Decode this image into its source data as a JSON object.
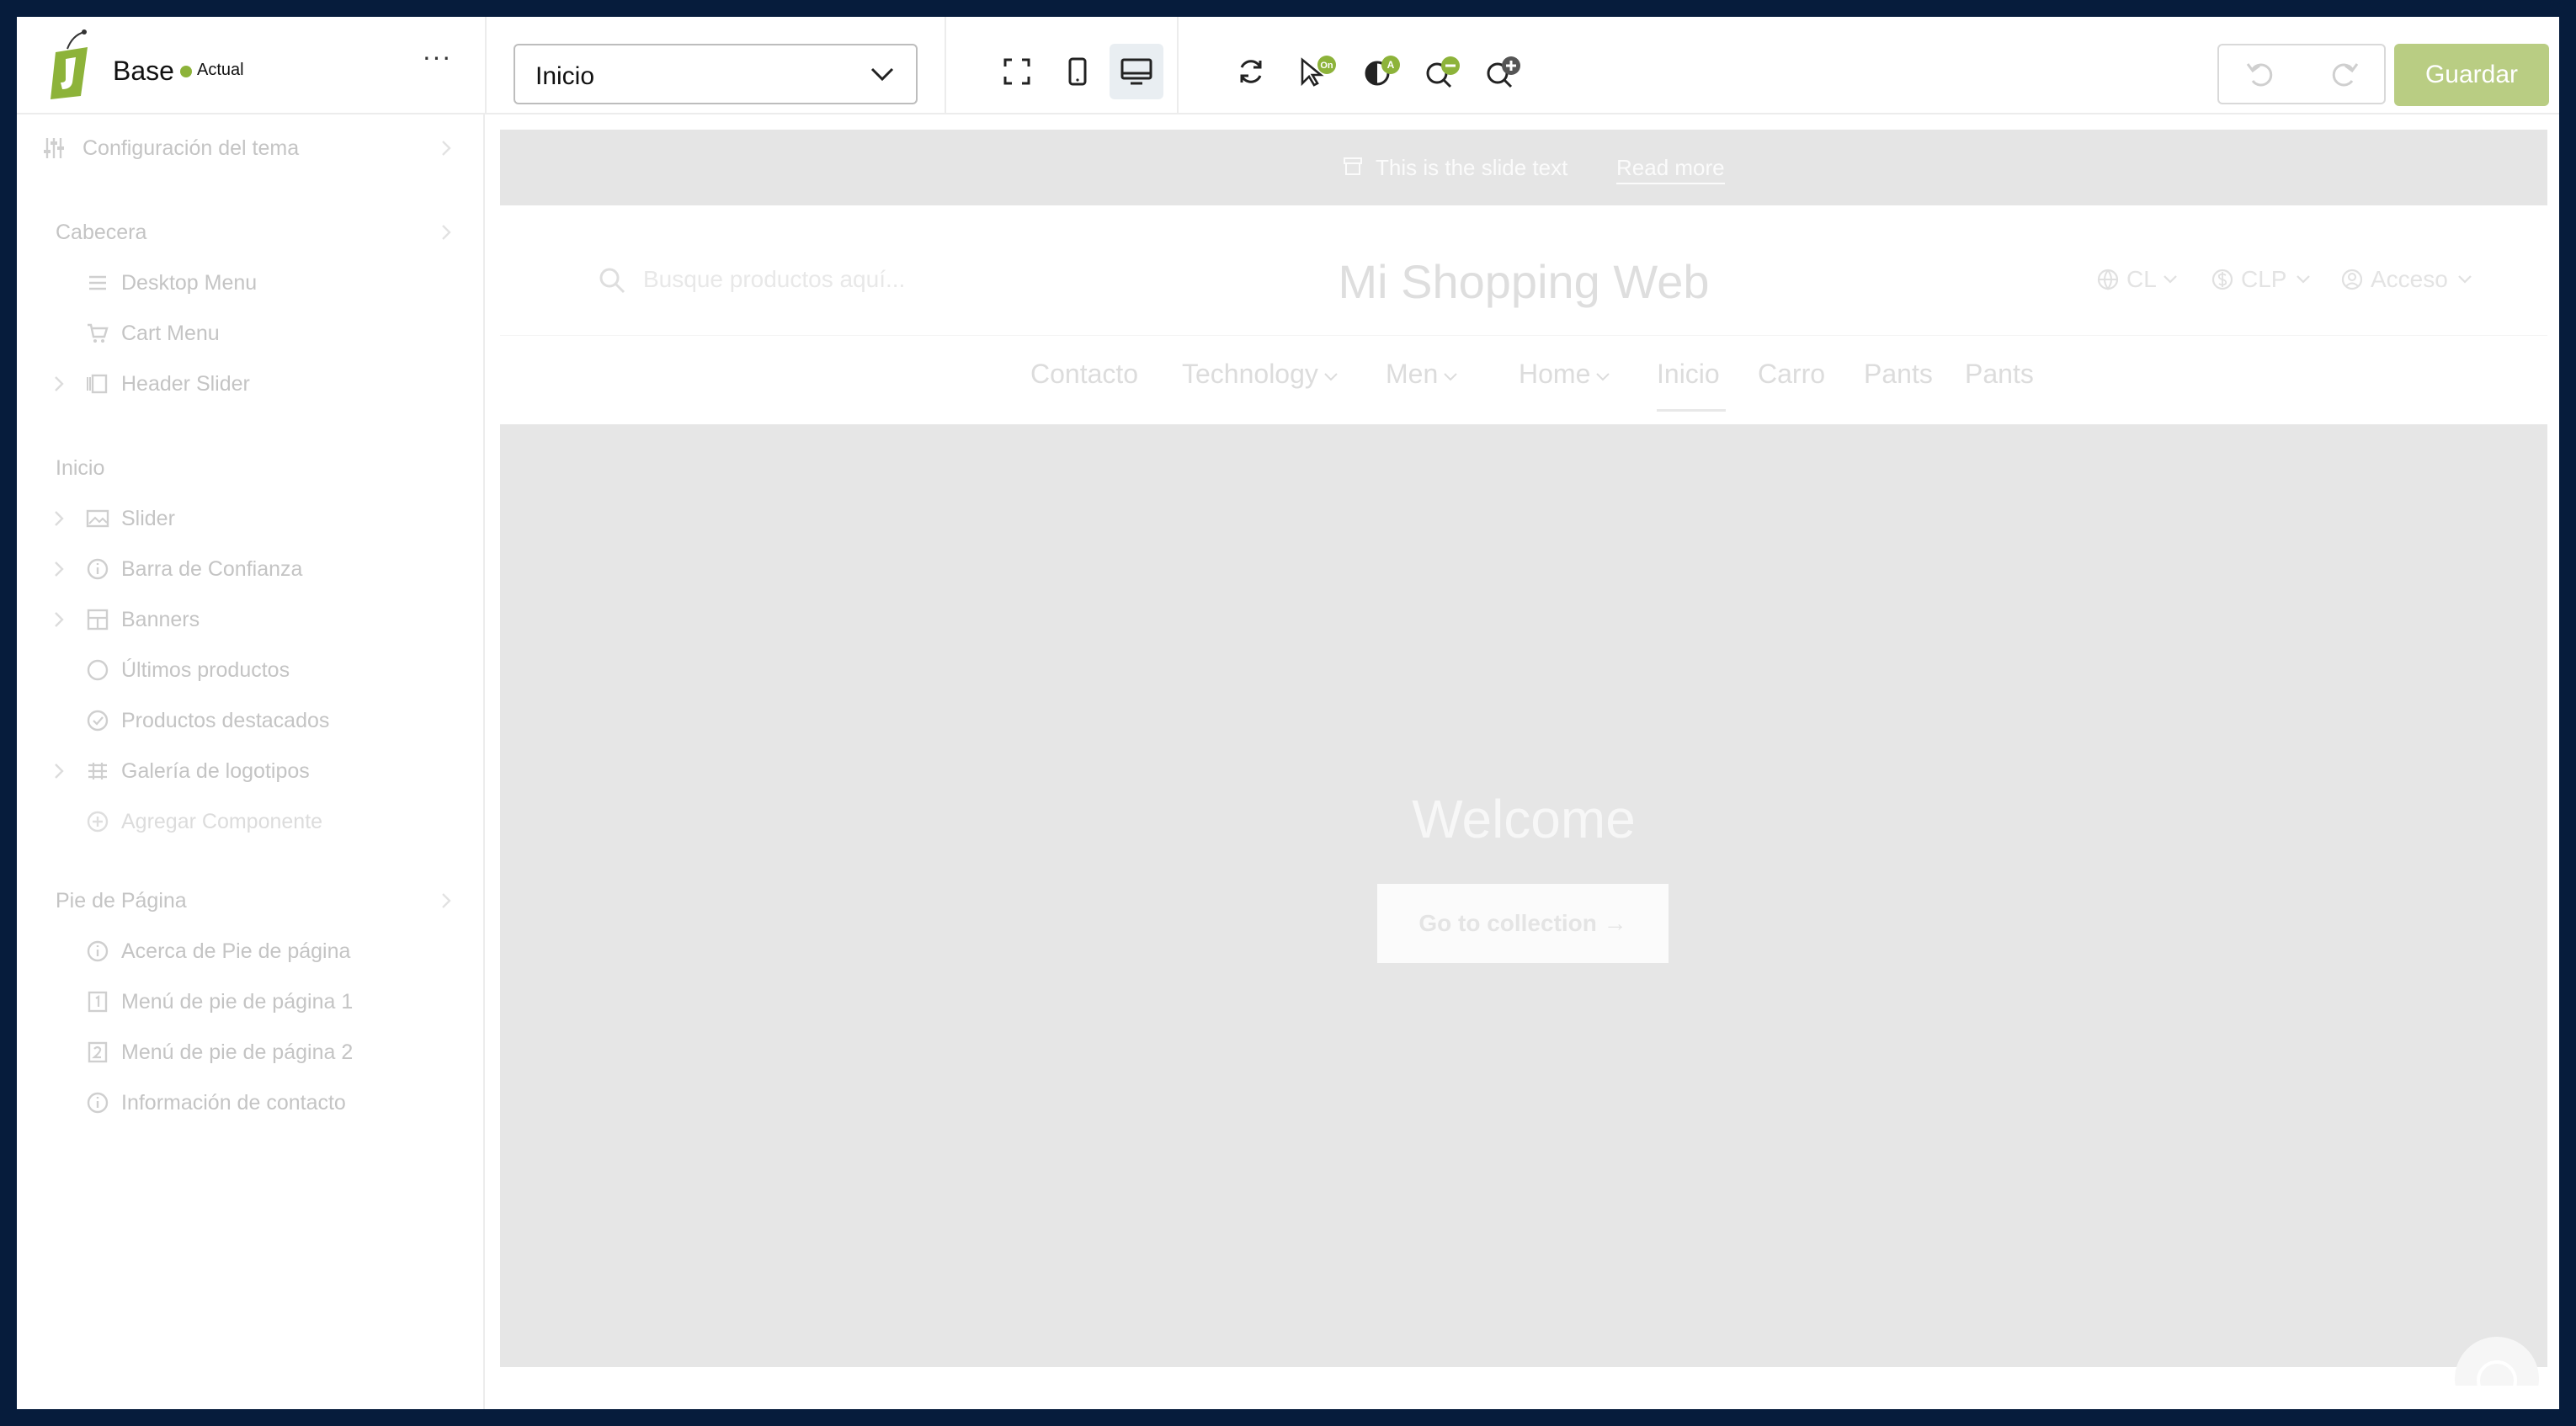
{
  "topbar": {
    "theme_name": "Base",
    "theme_status": "Actual",
    "more_label": "···",
    "page_select": {
      "value": "Inicio"
    },
    "save_label": "Guardar",
    "accent_color": "#8db33a"
  },
  "sidebar": {
    "theme_settings": "Configuración del tema",
    "groups": {
      "header": {
        "title": "Cabecera",
        "items": [
          {
            "label": "Desktop Menu",
            "icon": "menu-lines-icon"
          },
          {
            "label": "Cart Menu",
            "icon": "cart-icon"
          },
          {
            "label": "Header Slider",
            "icon": "slider-icon",
            "expandable": true
          }
        ]
      },
      "home": {
        "title": "Inicio",
        "items": [
          {
            "label": "Slider",
            "icon": "image-icon",
            "expandable": true
          },
          {
            "label": "Barra de Confianza",
            "icon": "info-icon",
            "expandable": true
          },
          {
            "label": "Banners",
            "icon": "grid-icon",
            "expandable": true
          },
          {
            "label": "Últimos productos",
            "icon": "circle-icon"
          },
          {
            "label": "Productos destacados",
            "icon": "check-circle-icon"
          },
          {
            "label": "Galería de logotipos",
            "icon": "logo-grid-icon",
            "expandable": true
          }
        ],
        "add_component": "Agregar Componente"
      },
      "footer": {
        "title": "Pie de Página",
        "items": [
          {
            "label": "Acerca de Pie de página",
            "icon": "info-icon"
          },
          {
            "label": "Menú de pie de página 1",
            "icon": "number-1-icon"
          },
          {
            "label": "Menú de pie de página 2",
            "icon": "number-2-icon"
          },
          {
            "label": "Información de contacto",
            "icon": "info-icon"
          }
        ]
      }
    }
  },
  "preview": {
    "announcement": {
      "text": "This is the slide text",
      "link": "Read more"
    },
    "header": {
      "search_placeholder": "Busque productos aquí...",
      "store_name": "Mi Shopping Web",
      "country": "CL",
      "currency": "CLP",
      "account": "Acceso"
    },
    "nav": [
      {
        "label": "Contacto",
        "dropdown": false
      },
      {
        "label": "Technology",
        "dropdown": true
      },
      {
        "label": "Men",
        "dropdown": true
      },
      {
        "label": "Home",
        "dropdown": true
      },
      {
        "label": "Inicio",
        "dropdown": false,
        "active": true
      },
      {
        "label": "Carro",
        "dropdown": false
      },
      {
        "label": "Pants",
        "dropdown": false
      },
      {
        "label": "Pants",
        "dropdown": false
      }
    ],
    "hero": {
      "title": "Welcome",
      "button": "Go to collection →",
      "slides": 3,
      "active_slide": 1
    }
  }
}
